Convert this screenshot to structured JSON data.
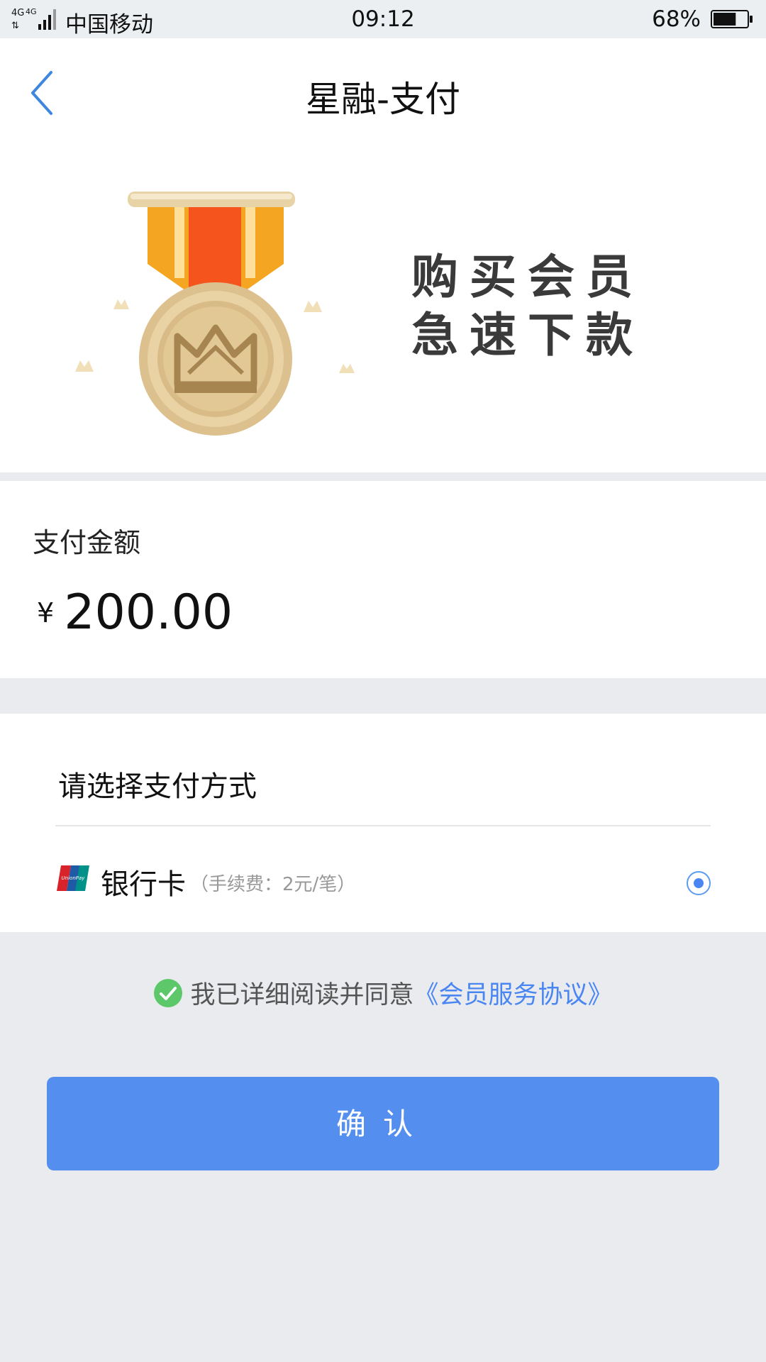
{
  "status_bar": {
    "network": "4G 4G",
    "carrier": "中国移动",
    "time": "09:12",
    "battery_percent": "68%",
    "battery_level": 0.68
  },
  "nav": {
    "title": "星融-支付",
    "back_icon": "chevron-left-icon"
  },
  "banner": {
    "line1": "购买会员",
    "line2": "急速下款",
    "image_icon": "medal-crown-icon"
  },
  "amount": {
    "label": "支付金额",
    "currency": "¥",
    "value": "200.00"
  },
  "payment": {
    "title": "请选择支付方式",
    "methods": [
      {
        "icon": "unionpay-icon",
        "label": "银行卡",
        "fee": "（手续费：2元/笔）",
        "selected": true
      }
    ]
  },
  "agreement": {
    "checked": true,
    "text": "我已详细阅读并同意",
    "link": "《会员服务协议》"
  },
  "confirm_button": {
    "label": "确认"
  },
  "colors": {
    "accent": "#548ff0",
    "link": "#4a86f2",
    "check": "#5cc86a",
    "background": "#e9ebee"
  }
}
